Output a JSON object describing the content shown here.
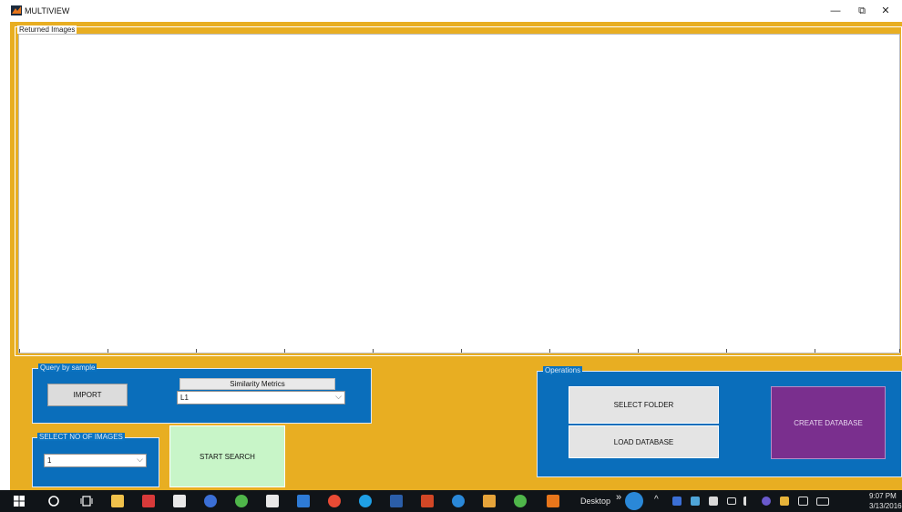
{
  "window": {
    "title": "MULTIVIEW",
    "minimize_glyph": "—",
    "restore_glyph": "⧉",
    "close_glyph": "✕"
  },
  "returned_panel": {
    "title": "Returned Images"
  },
  "query_panel": {
    "title": "Query by sample",
    "import_label": "IMPORT",
    "metrics_label": "Similarity Metrics",
    "metrics_value": "L1"
  },
  "images_panel": {
    "title": "SELECT NO OF IMAGES",
    "count_value": "1"
  },
  "search_label": "START SEARCH",
  "operations_panel": {
    "title": "Operations",
    "select_folder_label": "SELECT FOLDER",
    "load_database_label": "LOAD DATABASE",
    "create_database_label": "CREATE DATABASE"
  },
  "taskbar": {
    "desktop_label": "Desktop",
    "overflow_glyph": "»",
    "clock_time": "9:07 PM",
    "clock_date": "3/13/2016"
  },
  "colors": {
    "figure_bg": "#e8ae22",
    "panel_blue": "#0a6ebb",
    "search_green": "#c8f5c8",
    "create_purple": "#7a2f8e",
    "taskbar": "#101418"
  }
}
